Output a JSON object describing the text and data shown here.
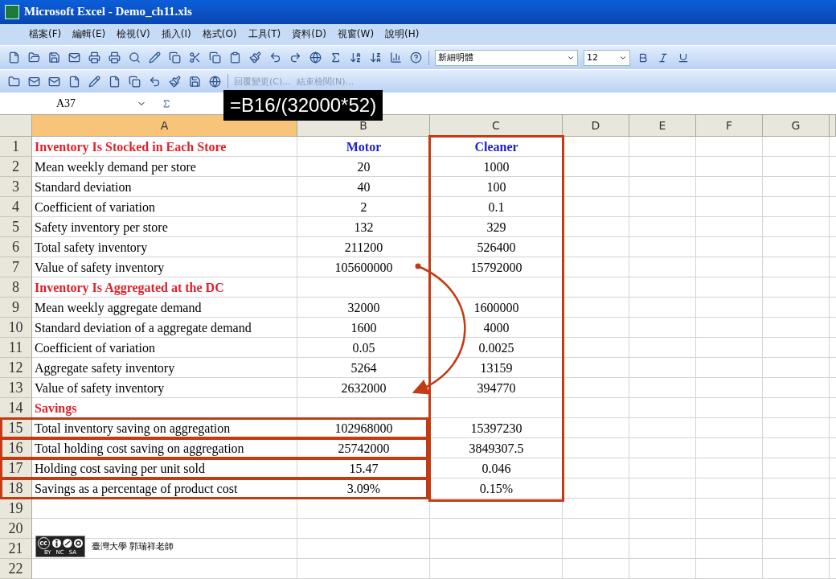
{
  "window": {
    "title": "Microsoft Excel - Demo_ch11.xls"
  },
  "menu": [
    "檔案(F)",
    "編輯(E)",
    "檢視(V)",
    "插入(I)",
    "格式(O)",
    "工具(T)",
    "資料(D)",
    "視窗(W)",
    "說明(H)"
  ],
  "font_box": {
    "font": "新細明體",
    "size": "12"
  },
  "review_toolbar": {
    "reply": "回覆變更(C)...",
    "end": "結束檢閱(N)..."
  },
  "name_box": "A37",
  "formula_callout": "=B16/(32000*52)",
  "columns": [
    {
      "letter": "A",
      "selected": true,
      "highlighted": false
    },
    {
      "letter": "B",
      "selected": false,
      "highlighted": false
    },
    {
      "letter": "C",
      "selected": false,
      "highlighted": true
    },
    {
      "letter": "D",
      "selected": false,
      "highlighted": false
    },
    {
      "letter": "E",
      "selected": false,
      "highlighted": false
    },
    {
      "letter": "F",
      "selected": false,
      "highlighted": false
    },
    {
      "letter": "G",
      "selected": false,
      "highlighted": false
    }
  ],
  "rows": [
    {
      "num": "1",
      "kind": "heading",
      "cells": [
        "Inventory Is Stocked in Each Store",
        "Motor",
        "Cleaner"
      ],
      "highlighted": false
    },
    {
      "num": "2",
      "kind": "data",
      "cells": [
        "Mean weekly demand per store",
        "20",
        "1000"
      ],
      "highlighted": false
    },
    {
      "num": "3",
      "kind": "data",
      "cells": [
        "Standard deviation",
        "40",
        "100"
      ],
      "highlighted": false
    },
    {
      "num": "4",
      "kind": "data",
      "cells": [
        "Coefficient of variation",
        "2",
        "0.1"
      ],
      "highlighted": false
    },
    {
      "num": "5",
      "kind": "data",
      "cells": [
        "Safety inventory per store",
        "132",
        "329"
      ],
      "highlighted": false
    },
    {
      "num": "6",
      "kind": "data",
      "cells": [
        "Total safety inventory",
        "211200",
        "526400"
      ],
      "highlighted": false
    },
    {
      "num": "7",
      "kind": "data",
      "cells": [
        "Value of safety inventory",
        "105600000",
        "15792000"
      ],
      "highlighted": false
    },
    {
      "num": "8",
      "kind": "section",
      "cells": [
        "Inventory Is Aggregated at the DC"
      ],
      "highlighted": false
    },
    {
      "num": "9",
      "kind": "data",
      "cells": [
        "Mean weekly aggregate demand",
        "32000",
        "1600000"
      ],
      "highlighted": false
    },
    {
      "num": "10",
      "kind": "data",
      "cells": [
        "Standard deviation of a aggregate demand",
        "1600",
        "4000"
      ],
      "highlighted": false
    },
    {
      "num": "11",
      "kind": "data",
      "cells": [
        "Coefficient of variation",
        "0.05",
        "0.0025"
      ],
      "highlighted": false
    },
    {
      "num": "12",
      "kind": "data",
      "cells": [
        "Aggregate safety inventory",
        "5264",
        "13159"
      ],
      "highlighted": false
    },
    {
      "num": "13",
      "kind": "data",
      "cells": [
        "Value of safety inventory",
        "2632000",
        "394770"
      ],
      "highlighted": false
    },
    {
      "num": "14",
      "kind": "section",
      "cells": [
        "Savings"
      ],
      "highlighted": false
    },
    {
      "num": "15",
      "kind": "data",
      "cells": [
        "Total inventory saving on aggregation",
        "102968000",
        "15397230"
      ],
      "highlighted": true
    },
    {
      "num": "16",
      "kind": "data",
      "cells": [
        "Total holding cost saving on aggregation",
        "25742000",
        "3849307.5"
      ],
      "highlighted": true
    },
    {
      "num": "17",
      "kind": "data",
      "cells": [
        "Holding cost saving per unit sold",
        "15.47",
        "0.046"
      ],
      "highlighted": true
    },
    {
      "num": "18",
      "kind": "data",
      "cells": [
        "Savings as a percentage of product cost",
        "3.09%",
        "0.15%"
      ],
      "highlighted": true
    },
    {
      "num": "19",
      "kind": "empty",
      "cells": [],
      "highlighted": false
    },
    {
      "num": "20",
      "kind": "empty",
      "cells": [],
      "highlighted": false
    },
    {
      "num": "21",
      "kind": "empty",
      "cells": [],
      "highlighted": false
    },
    {
      "num": "22",
      "kind": "empty",
      "cells": [],
      "highlighted": false
    }
  ],
  "credit": {
    "badge": {
      "logo": "cc",
      "labels": [
        "BY",
        "NC",
        "SA"
      ]
    },
    "text": "臺灣大學 郭瑞祥老師"
  }
}
